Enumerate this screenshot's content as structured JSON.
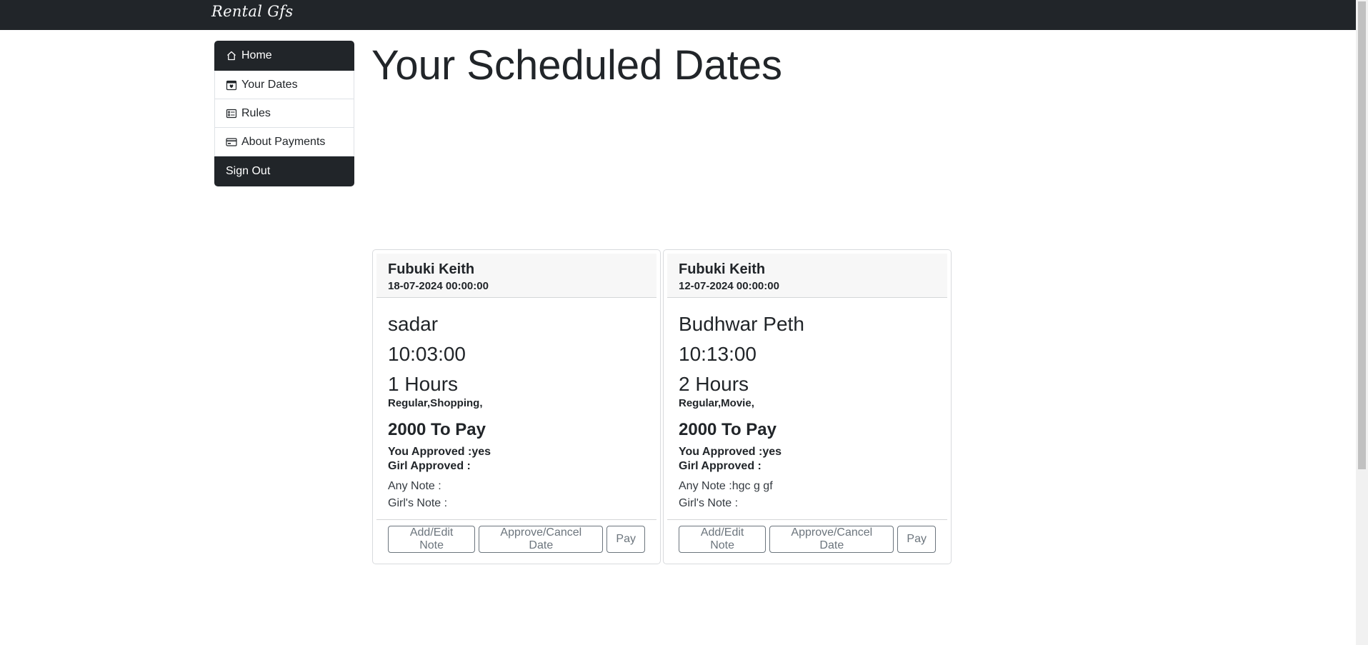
{
  "brand": "Rental Gfs",
  "sidebar": {
    "items": [
      {
        "label": "Home",
        "icon": "home-icon"
      },
      {
        "label": "Your Dates",
        "icon": "calendar-heart-icon"
      },
      {
        "label": "Rules",
        "icon": "list-card-icon"
      },
      {
        "label": "About Payments",
        "icon": "credit-card-icon"
      },
      {
        "label": "Sign Out"
      }
    ]
  },
  "page_title": "Your Scheduled Dates",
  "cards": [
    {
      "name": "Fubuki Keith",
      "date": "18-07-2024 00:00:00",
      "place": "sadar",
      "time": "10:03:00",
      "duration": "1 Hours",
      "tags": "Regular,Shopping,",
      "pay": "2000 To Pay",
      "you_approved": "You Approved :yes",
      "girl_approved": "Girl Approved :",
      "any_note": "Any Note :",
      "girls_note": "Girl's Note :",
      "buttons": {
        "edit_note": "Add/Edit Note",
        "approve_cancel": "Approve/Cancel Date",
        "pay": "Pay"
      }
    },
    {
      "name": "Fubuki Keith",
      "date": "12-07-2024 00:00:00",
      "place": "Budhwar Peth",
      "time": "10:13:00",
      "duration": "2 Hours",
      "tags": "Regular,Movie,",
      "pay": "2000 To Pay",
      "you_approved": "You Approved :yes",
      "girl_approved": "Girl Approved :",
      "any_note": "Any Note :hgc g gf",
      "girls_note": "Girl's Note :",
      "buttons": {
        "edit_note": "Add/Edit Note",
        "approve_cancel": "Approve/Cancel Date",
        "pay": "Pay"
      }
    }
  ],
  "colors": {
    "navbar": "#212529",
    "button_outline": "#6c757d"
  }
}
